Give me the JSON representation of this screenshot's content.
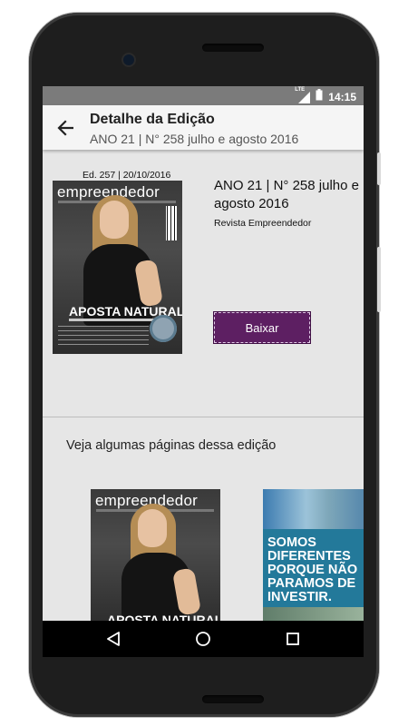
{
  "status_bar": {
    "network_label": "LTE",
    "time": "14:15"
  },
  "app_bar": {
    "title": "Detalhe da Edição",
    "subtitle": "ANO 21 | N° 258 julho e agosto 2016"
  },
  "edition": {
    "cover_date": "Ed. 257 | 20/10/2016",
    "title": "ANO 21 | N° 258 julho e agosto 2016",
    "publisher": "Revista Empreendedor",
    "download_label": "Baixar"
  },
  "cover": {
    "magazine_name": "empreendedor",
    "headline": "APOSTA NATURAL"
  },
  "preview": {
    "heading": "Veja algumas páginas dessa edição",
    "page_two_lines": [
      "SOMOS",
      "DIFERENTES",
      "PORQUE NÃO",
      "PARAMOS DE",
      "INVESTIR."
    ]
  },
  "colors": {
    "download_button": "#5d1f62",
    "status_bar": "#7b7b7b",
    "ad_band": "#23799a"
  },
  "icons": {
    "back": "arrow-left-icon",
    "nav_back": "triangle-back-icon",
    "nav_home": "circle-home-icon",
    "nav_recents": "square-recents-icon"
  }
}
